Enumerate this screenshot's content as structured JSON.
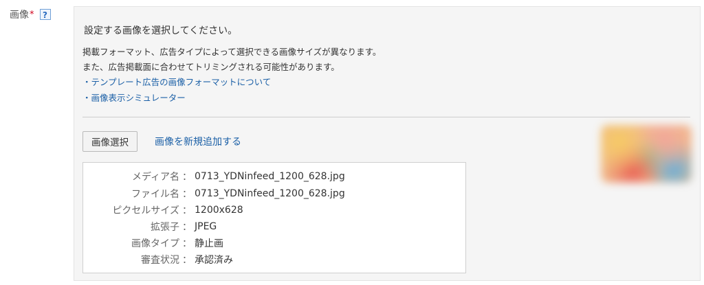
{
  "field": {
    "label": "画像",
    "required_mark": "*",
    "help_icon": "?"
  },
  "instructions": {
    "title": "設定する画像を選択してください。",
    "line1": "掲載フォーマット、広告タイプによって選択できる画像サイズが異なります。",
    "line2": "また、広告掲載面に合わせてトリミングされる可能性があります。",
    "link1": "・テンプレート広告の画像フォーマットについて",
    "link2": "・画像表示シミュレーター"
  },
  "actions": {
    "select_button": "画像選択",
    "add_new_link": "画像を新規追加する"
  },
  "details": {
    "separator": "：",
    "rows": [
      {
        "label": "メディア名",
        "value": "0713_YDNinfeed_1200_628.jpg"
      },
      {
        "label": "ファイル名",
        "value": "0713_YDNinfeed_1200_628.jpg"
      },
      {
        "label": "ピクセルサイズ",
        "value": "1200x628"
      },
      {
        "label": "拡張子",
        "value": "JPEG"
      },
      {
        "label": "画像タイプ",
        "value": "静止画"
      },
      {
        "label": "審査状況",
        "value": "承認済み"
      }
    ]
  },
  "thumbnail": {
    "icon": "image-thumbnail-blurred"
  }
}
